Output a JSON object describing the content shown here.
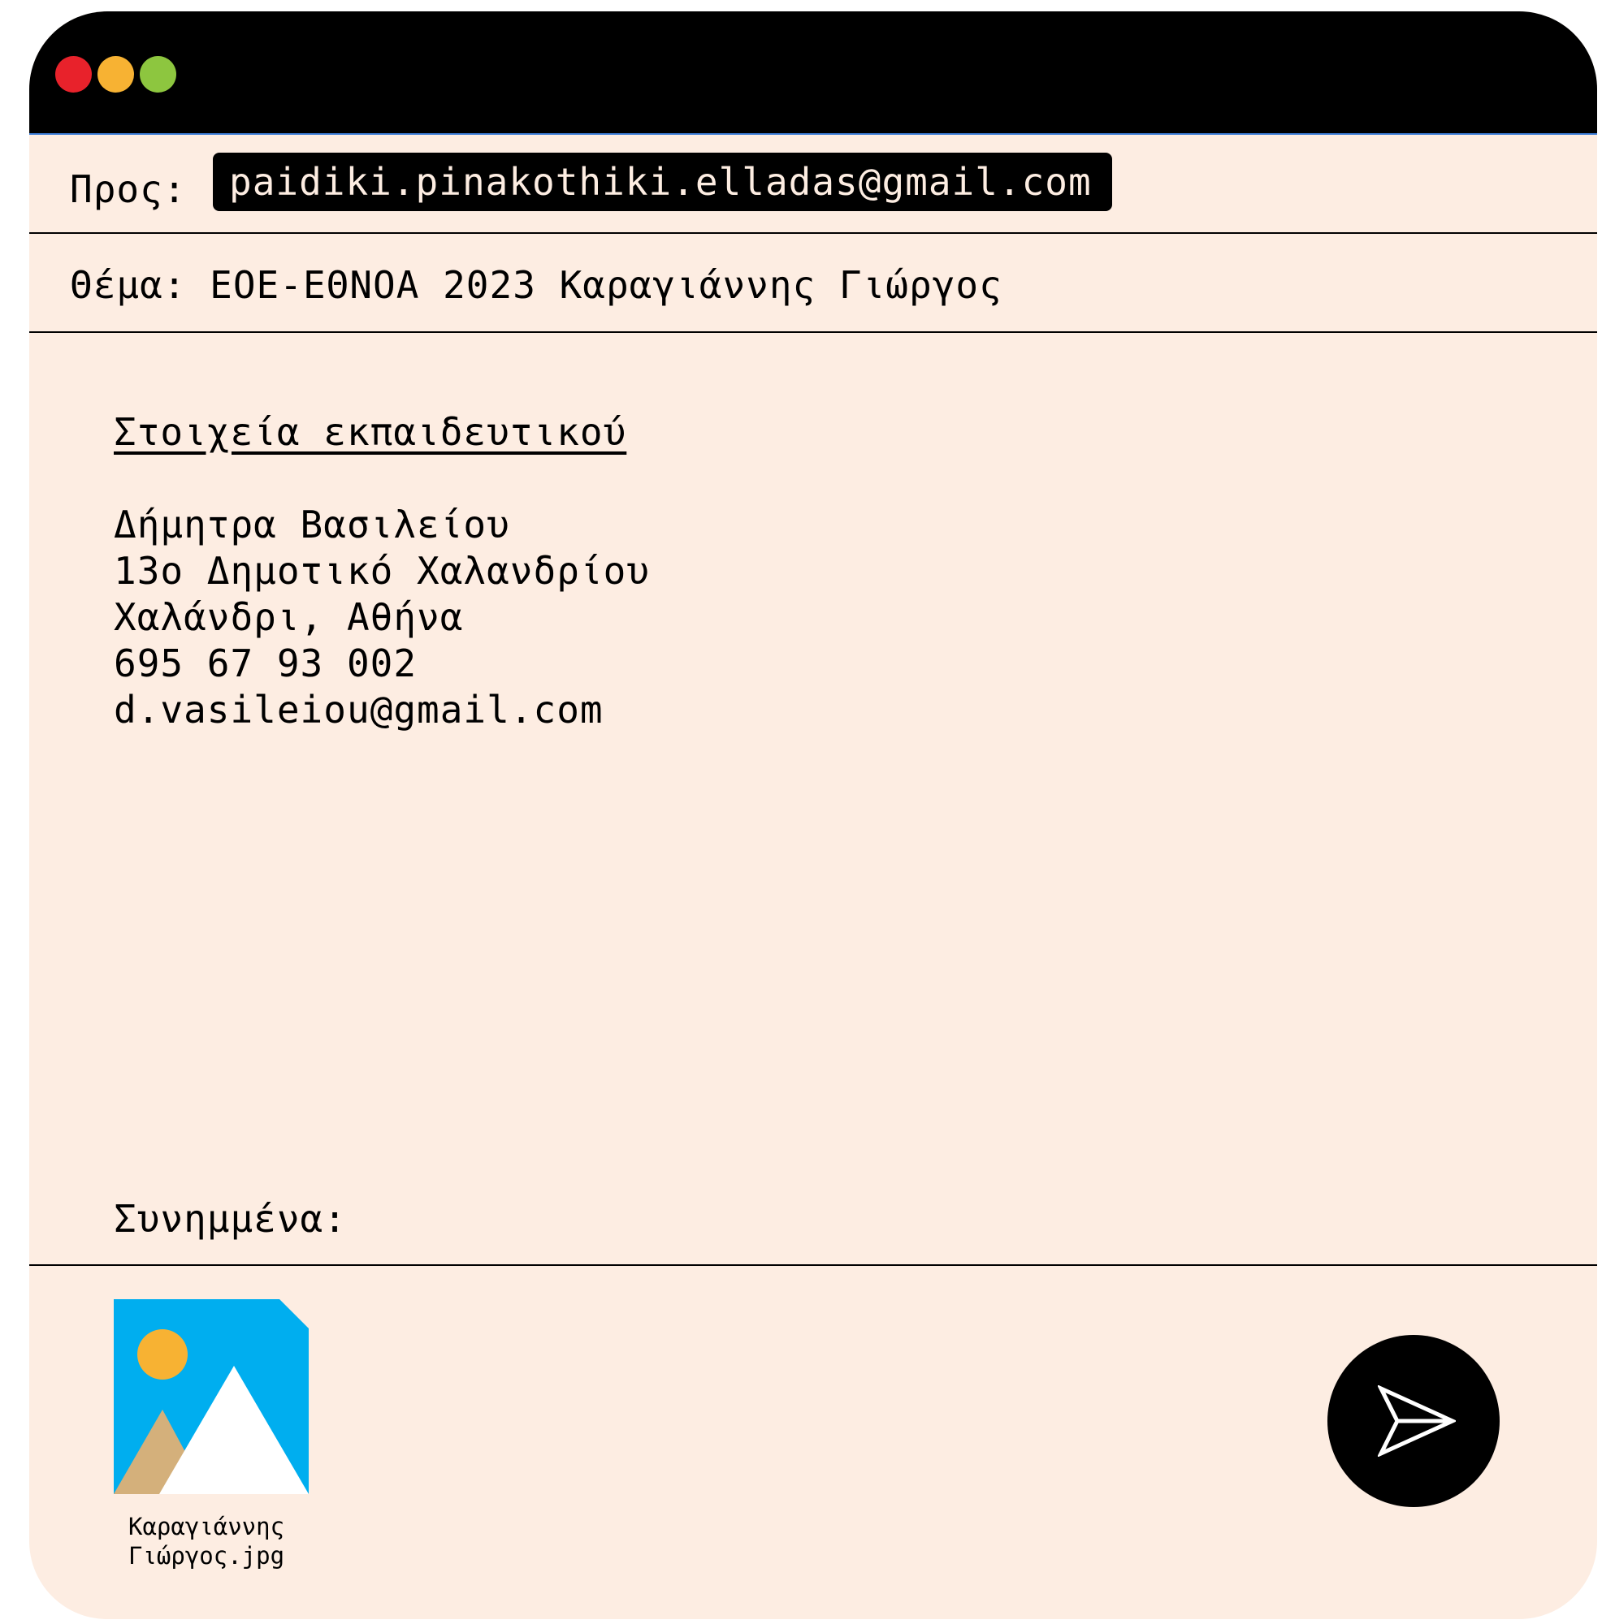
{
  "window": {
    "controls": {
      "close_color": "#E8222B",
      "minimize_color": "#F7B233",
      "maximize_color": "#8DC63F"
    }
  },
  "header": {
    "to_label": "Προς:",
    "to_value": "paidiki.pinakothiki.elladas@gmail.com",
    "subject_text": "Θέμα: ΕΟΕ-ΕΘΝΟΑ 2023 Καραγιάννης Γιώργος"
  },
  "body": {
    "section_heading": "Στοιχεία εκπαιδευτικού",
    "lines": [
      "Δήμητρα Βασιλείου",
      "13ο Δημοτικό Χαλανδρίου",
      "Χαλάνδρι, Αθήνα",
      "695 67 93 002",
      "d.vasileiou@gmail.com"
    ]
  },
  "attachments": {
    "label": "Συνημμένα:",
    "items": [
      {
        "icon": "image-file-icon",
        "name": "Καραγιάννης\nΓιώργος.jpg"
      }
    ]
  },
  "actions": {
    "send_icon": "send-icon"
  }
}
